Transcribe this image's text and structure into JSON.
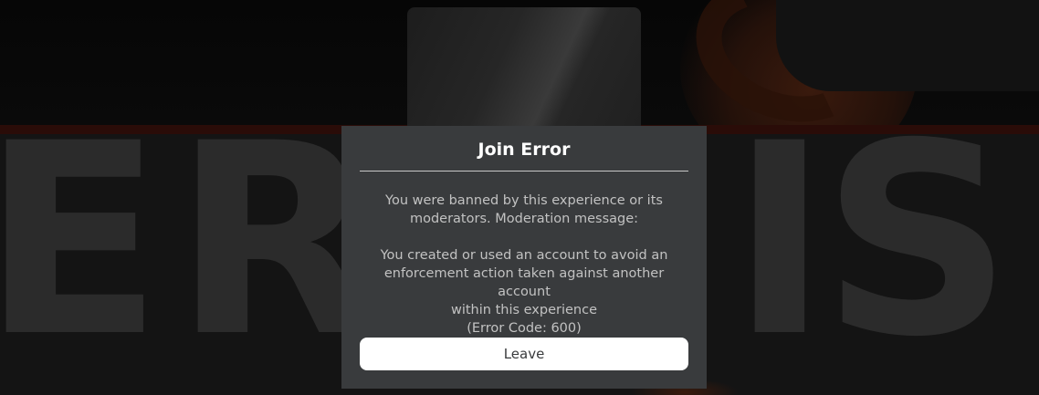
{
  "dialog": {
    "title": "Join Error",
    "message_lines": [
      "You were banned by this experience or its",
      "moderators. Moderation message:",
      "",
      "You created or used an account to avoid an",
      "enforcement action taken against another account",
      "within this experience",
      "(Error Code: 600)"
    ],
    "leave_label": "Leave"
  },
  "background": {
    "letters": [
      "E",
      "R",
      "I",
      "S"
    ]
  },
  "colors": {
    "modal_bg": "#393b3d",
    "title_text": "#ffffff",
    "body_text": "#c2c2c2",
    "button_bg": "#ffffff",
    "button_text": "#393b3d",
    "accent_orange": "#3a1a0d"
  }
}
